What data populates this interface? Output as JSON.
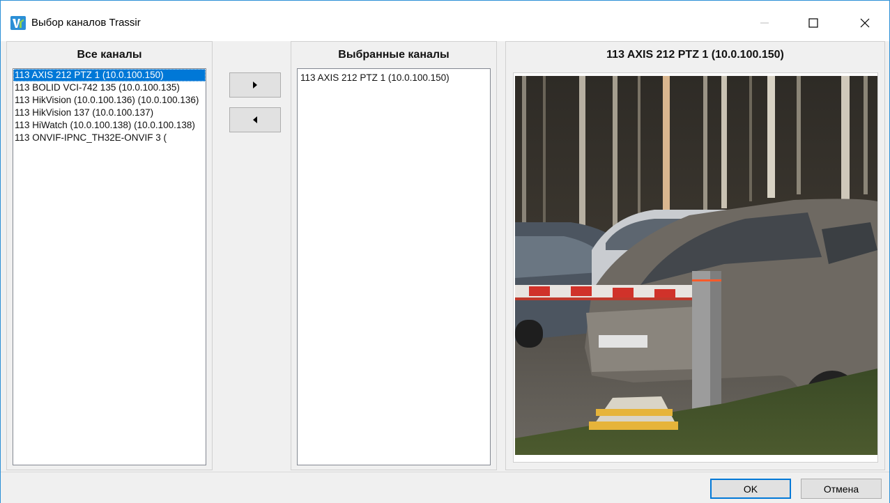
{
  "window": {
    "title": "Выбор каналов Trassir",
    "border_color": "#2b8fd6"
  },
  "icons": {
    "app": "trassir-logo-icon",
    "minimize": "minimize-icon",
    "maximize": "maximize-icon",
    "close": "close-icon",
    "add": "triangle-right-icon",
    "remove": "triangle-left-icon"
  },
  "all_channels": {
    "title": "Все каналы",
    "items": [
      {
        "label": "113 AXIS 212 PTZ 1 (10.0.100.150)",
        "selected": true
      },
      {
        "label": "113 BOLID VCI-742 135 (10.0.100.135)",
        "selected": false
      },
      {
        "label": "113 HikVision (10.0.100.136) (10.0.100.136)",
        "selected": false
      },
      {
        "label": "113 HikVision 137 (10.0.100.137)",
        "selected": false
      },
      {
        "label": "113 HiWatch (10.0.100.138) (10.0.100.138)",
        "selected": false
      },
      {
        "label": "113 ONVIF-IPNC_TH32E-ONVIF 3 (",
        "selected": false
      }
    ]
  },
  "selected_channels": {
    "title": "Выбранные каналы",
    "items": [
      {
        "label": "113 AXIS 212 PTZ 1 (10.0.100.150)"
      }
    ]
  },
  "preview": {
    "title": "113 AXIS 212 PTZ 1 (10.0.100.150)"
  },
  "buttons": {
    "ok": "OK",
    "cancel": "Отмена"
  },
  "colors": {
    "selection": "#0078d7",
    "accent": "#2b8fd6"
  }
}
